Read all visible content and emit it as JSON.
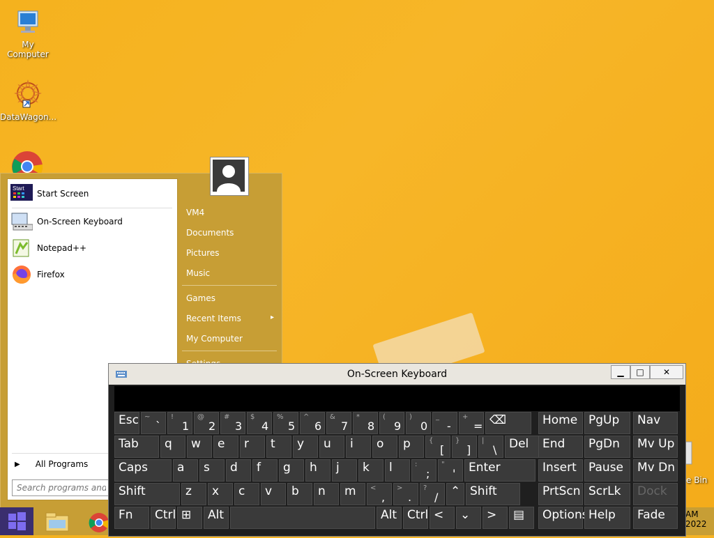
{
  "desktop": {
    "icons": [
      {
        "label": "My Computer"
      },
      {
        "label": "DataWagon..."
      },
      {
        "label": "Recycle Bin",
        "visible_label": "e Bin"
      }
    ]
  },
  "start_menu": {
    "pinned": [
      {
        "label": "Start Screen",
        "icon": "start-screen-icon",
        "icon_text": "Start"
      },
      {
        "label": "On-Screen Keyboard",
        "icon": "keyboard-icon"
      },
      {
        "label": "Notepad++",
        "icon": "notepadpp-icon"
      },
      {
        "label": "Firefox",
        "icon": "firefox-icon"
      }
    ],
    "all_programs": "All Programs",
    "search_placeholder": "Search programs and files",
    "right_items": [
      {
        "label": "VM4"
      },
      {
        "label": "Documents"
      },
      {
        "label": "Pictures"
      },
      {
        "label": "Music"
      },
      {
        "label": "Games"
      },
      {
        "label": "Recent Items",
        "arrow": "▸"
      },
      {
        "label": "My Computer"
      },
      {
        "label": "Settings"
      }
    ]
  },
  "osk": {
    "title": "On-Screen Keyboard",
    "controls": {
      "minimize": "▁",
      "restore": "□",
      "close": "✕"
    },
    "rows": [
      [
        {
          "t": "Esc"
        },
        {
          "s": "~",
          "m": "`"
        },
        {
          "s": "!",
          "m": "1"
        },
        {
          "s": "@",
          "m": "2"
        },
        {
          "s": "#",
          "m": "3"
        },
        {
          "s": "$",
          "m": "4"
        },
        {
          "s": "%",
          "m": "5"
        },
        {
          "s": "^",
          "m": "6"
        },
        {
          "s": "&",
          "m": "7"
        },
        {
          "s": "*",
          "m": "8"
        },
        {
          "s": "(",
          "m": "9"
        },
        {
          "s": ")",
          "m": "0"
        },
        {
          "s": "_",
          "m": "-"
        },
        {
          "s": "+",
          "m": "="
        },
        {
          "t": "⌫"
        }
      ],
      [
        {
          "t": "Tab"
        },
        {
          "t": "q"
        },
        {
          "t": "w"
        },
        {
          "t": "e"
        },
        {
          "t": "r"
        },
        {
          "t": "t"
        },
        {
          "t": "y"
        },
        {
          "t": "u"
        },
        {
          "t": "i"
        },
        {
          "t": "o"
        },
        {
          "t": "p"
        },
        {
          "s": "{",
          "m": "["
        },
        {
          "s": "}",
          "m": "]"
        },
        {
          "s": "|",
          "m": "\\"
        },
        {
          "t": "Del"
        }
      ],
      [
        {
          "t": "Caps"
        },
        {
          "t": "a"
        },
        {
          "t": "s"
        },
        {
          "t": "d"
        },
        {
          "t": "f"
        },
        {
          "t": "g"
        },
        {
          "t": "h"
        },
        {
          "t": "j"
        },
        {
          "t": "k"
        },
        {
          "t": "l"
        },
        {
          "s": ":",
          "m": ";"
        },
        {
          "s": "\"",
          "m": "'"
        },
        {
          "t": "Enter"
        }
      ],
      [
        {
          "t": "Shift"
        },
        {
          "t": "z"
        },
        {
          "t": "x"
        },
        {
          "t": "c"
        },
        {
          "t": "v"
        },
        {
          "t": "b"
        },
        {
          "t": "n"
        },
        {
          "t": "m"
        },
        {
          "s": "<",
          "m": ","
        },
        {
          "s": ">",
          "m": "."
        },
        {
          "s": "?",
          "m": "/"
        },
        {
          "t": "⌃"
        },
        {
          "t": "Shift"
        }
      ],
      [
        {
          "t": "Fn"
        },
        {
          "t": "Ctrl"
        },
        {
          "t": "⊞"
        },
        {
          "t": "Alt"
        },
        {
          "t": ""
        },
        {
          "t": "Alt"
        },
        {
          "t": "Ctrl"
        },
        {
          "t": "<"
        },
        {
          "t": "⌄"
        },
        {
          "t": ">"
        },
        {
          "t": "▤"
        }
      ]
    ],
    "nav_keys": [
      [
        "Home",
        "PgUp",
        "Nav"
      ],
      [
        "End",
        "PgDn",
        "Mv Up"
      ],
      [
        "Insert",
        "Pause",
        "Mv Dn"
      ],
      [
        "PrtScn",
        "ScrLk",
        "Dock"
      ],
      [
        "Options",
        "Help",
        "Fade"
      ]
    ]
  },
  "taskbar": {
    "clock_time": "AM",
    "clock_date": "2022"
  },
  "colors": {
    "wallpaper": "#f5b21e",
    "start_menu": "#c79e35",
    "osk_bg": "#1f1f1f",
    "key": "#3a3a3a"
  }
}
